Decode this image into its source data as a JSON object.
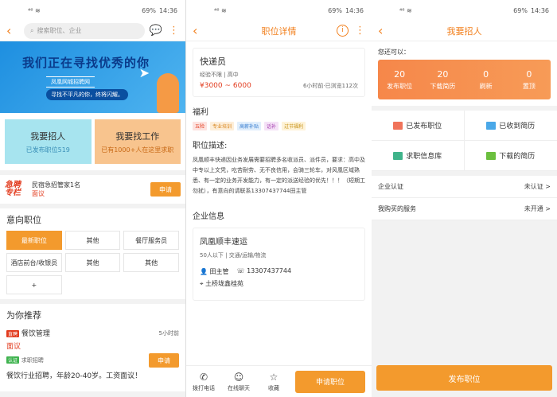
{
  "status": {
    "signal": "⁴⁶",
    "battery": "69%",
    "time": "14:36"
  },
  "s1": {
    "search_placeholder": "搜索职位、企业",
    "banner_title": "我们正在寻找优秀的你",
    "banner_sub": "凤凰网城招聘网",
    "banner_slogan": "寻找不平凡的你，终将闪耀。",
    "card_recruit": {
      "title": "我要招人",
      "sub": "已发布职位519"
    },
    "card_job": {
      "title": "我要找工作",
      "sub": "已有1000+人在这里求职"
    },
    "urgent": {
      "logo": "急聘专栏",
      "job": "民宿急招管家1名",
      "pay": "面议",
      "btn": "申请"
    },
    "intent_title": "意向职位",
    "intent": [
      "最新职位",
      "其他",
      "餐厅服务员",
      "酒店前台/收银员",
      "其他",
      "其他",
      "+"
    ],
    "rec_title": "为你推荐",
    "rec": {
      "tag": "直聘",
      "name": "餐饮管理",
      "time": "5小时前",
      "pay": "面议",
      "verify": "认证",
      "src": "求职招聘",
      "btn": "申请",
      "desc": "餐饮行业招聘，年龄20-40岁。工资面议！"
    }
  },
  "s2": {
    "title": "职位详情",
    "job": "快递员",
    "meta": "经验不限 | 高中",
    "salary": "¥3000 ~ 6000",
    "posted": "6小时前·已浏览112次",
    "welfare_title": "福利",
    "welfare": [
      "五险",
      "专业培训",
      "高薪补贴",
      "话补",
      "过节福利"
    ],
    "desc_title": "职位描述:",
    "desc": "凤凰顺丰快递因业务发展需要招聘多名收派员、派件员，要求：高中及中专以上文凭，吃苦耐劳、无不良信用，会骑三轮车，对风凰区域熟悉、有一定的业务开发能力，有一定的派送经验的优先！！！（短期工勿扰），有意向的请联系13307437744田主管",
    "co_title": "企业信息",
    "co": {
      "name": "凤凰顺丰速运",
      "meta": "50人以下 | 交通/运输/物流",
      "contact": "田主管",
      "phone": "13307437744",
      "addr": "土桥垅鑫桂苑"
    },
    "foot": {
      "call": "拨打电话",
      "chat": "在线聊天",
      "fav": "收藏",
      "apply": "申请职位"
    }
  },
  "s3": {
    "title": "我要招人",
    "can": "您还可以：",
    "stats": [
      {
        "n": "20",
        "t": "发布职位"
      },
      {
        "n": "20",
        "t": "下载简历"
      },
      {
        "n": "0",
        "t": "刷新"
      },
      {
        "n": "0",
        "t": "置顶"
      }
    ],
    "menu": [
      "已发布职位",
      "已收到简历",
      "求职信息库",
      "下载的简历"
    ],
    "rows": [
      {
        "k": "企业认证",
        "v": "未认证 >"
      },
      {
        "k": "我购买的服务",
        "v": "未开通 >"
      }
    ],
    "publish": "发布职位"
  },
  "colors": {
    "accent": "#f39a2d",
    "red": "#e23b1e"
  }
}
